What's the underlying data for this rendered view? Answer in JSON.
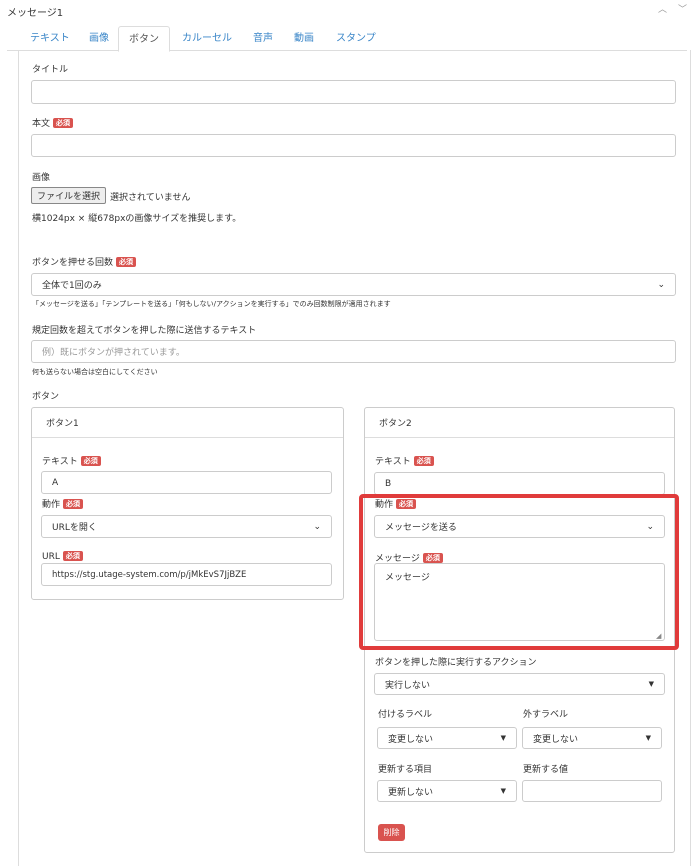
{
  "header": {
    "title": "メッセージ1"
  },
  "tabs": [
    {
      "label": "テキスト"
    },
    {
      "label": "画像"
    },
    {
      "label": "ボタン"
    },
    {
      "label": "カルーセル"
    },
    {
      "label": "音声"
    },
    {
      "label": "動画"
    },
    {
      "label": "スタンプ"
    }
  ],
  "form": {
    "title_label": "タイトル",
    "title_value": "",
    "body_label": "本文",
    "required": "必須",
    "image_label": "画像",
    "file_button": "ファイルを選択",
    "file_status": "選択されていません",
    "image_hint": "横1024px × 縦678pxの画像サイズを推奨します。",
    "press_count_label": "ボタンを押せる回数",
    "press_count_value": "全体で1回のみ",
    "press_count_note": "「メッセージを送る」「テンプレートを送る」「何もしない/アクションを実行する」でのみ回数制限が適用されます",
    "over_text_label": "規定回数を超えてボタンを押した際に送信するテキスト",
    "over_text_placeholder": "例）既にボタンが押されています。",
    "over_text_note": "何も送らない場合は空白にしてください",
    "buttons_label": "ボタン"
  },
  "button1": {
    "header": "ボタン1",
    "text_label": "テキスト",
    "text_value": "A",
    "action_label": "動作",
    "action_value": "URLを開く",
    "url_label": "URL",
    "url_value": "https://stg.utage-system.com/p/jMkEvS7JjBZE"
  },
  "button2": {
    "header": "ボタン2",
    "text_label": "テキスト",
    "text_value": "B",
    "action_label": "動作",
    "action_value": "メッセージを送る",
    "message_label": "メッセージ",
    "message_value": "メッセージ",
    "press_action_label": "ボタンを押した際に実行するアクション",
    "press_action_value": "実行しない",
    "add_label_label": "付けるラベル",
    "add_label_value": "変更しない",
    "remove_label_label": "外すラベル",
    "remove_label_value": "変更しない",
    "update_field_label": "更新する項目",
    "update_field_value": "更新しない",
    "update_value_label": "更新する値",
    "update_value_value": "",
    "delete_button": "削除"
  }
}
